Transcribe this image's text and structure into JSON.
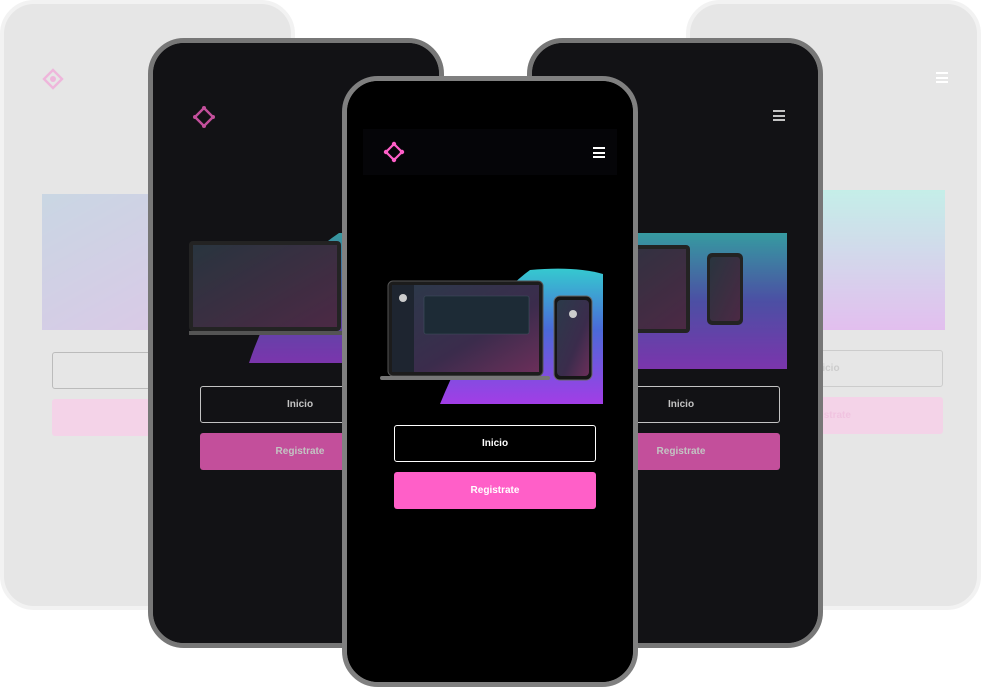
{
  "app": {
    "brand_color": "#ff5fc8",
    "logo_icon": "diamond-logo-icon",
    "menu_icon": "hamburger-menu-icon"
  },
  "buttons": {
    "login_label": "Inicio",
    "register_label": "Registrate"
  }
}
